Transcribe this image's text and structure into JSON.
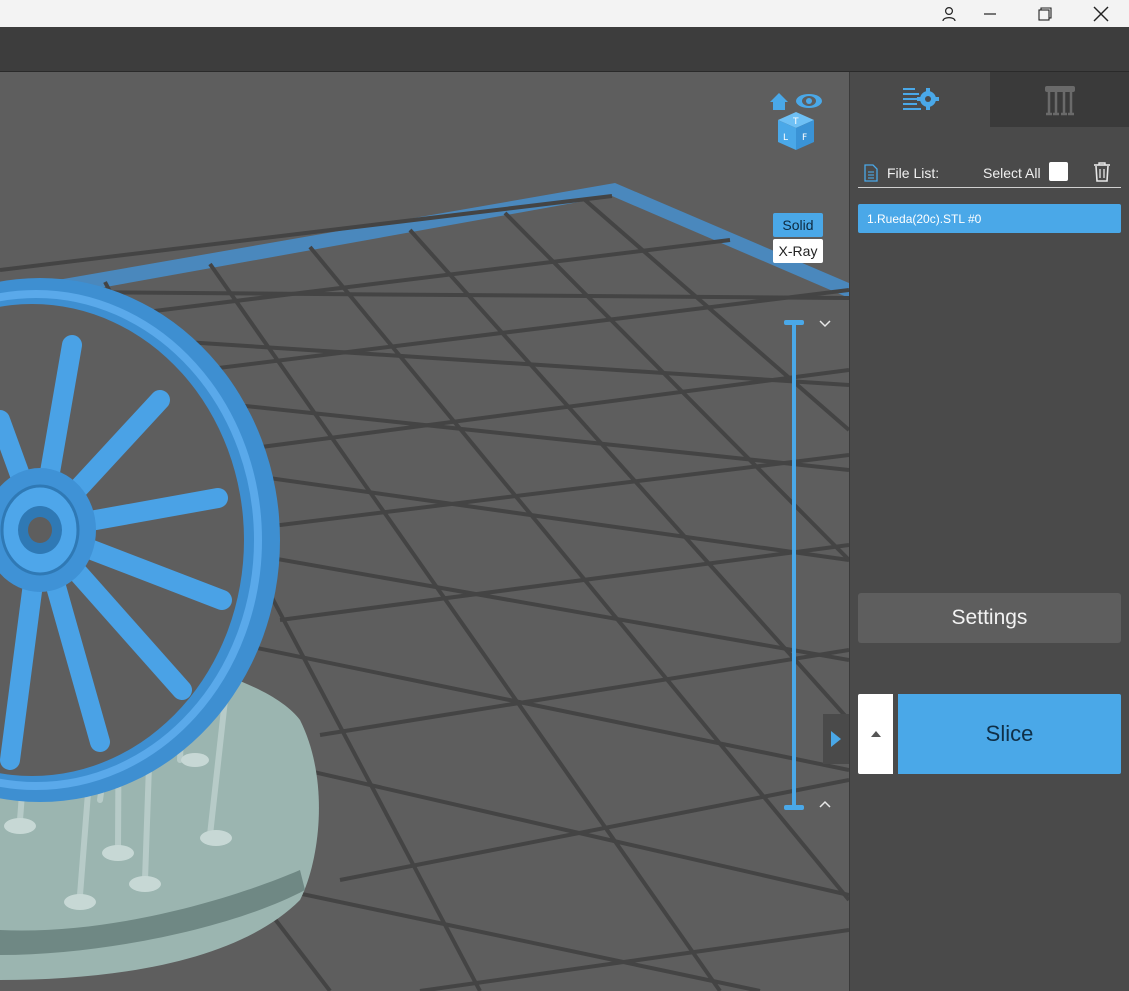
{
  "window": {
    "controls": [
      "user-icon",
      "minimize-icon",
      "restore-icon",
      "close-icon"
    ]
  },
  "viewport": {
    "view_modes": {
      "solid": "Solid",
      "xray": "X-Ray",
      "active": "Solid"
    },
    "view_cube_faces": [
      "T",
      "L",
      "F"
    ],
    "accent": "#4aa8e8"
  },
  "panel": {
    "tabs": [
      {
        "name": "print-settings",
        "icon": "list-gear-icon",
        "active": true
      },
      {
        "name": "supports",
        "icon": "supports-icon",
        "active": false
      }
    ],
    "file_list": {
      "label": "File List:",
      "select_all_label": "Select All",
      "select_all_checked": false,
      "items": [
        "1.Rueda(20c).STL #0"
      ]
    },
    "settings_label": "Settings",
    "slice_label": "Slice"
  }
}
